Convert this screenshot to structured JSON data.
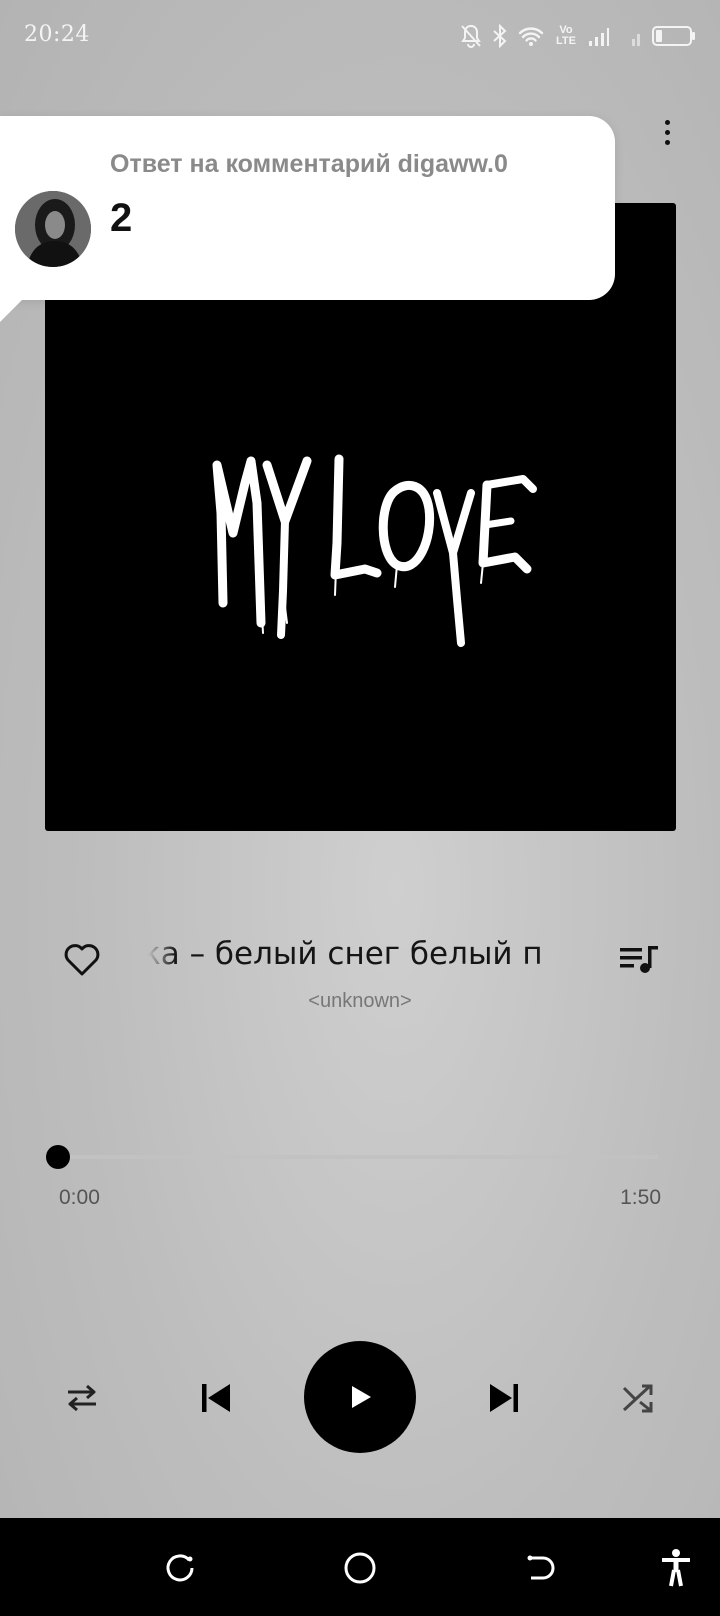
{
  "status_bar": {
    "time": "20:24",
    "network_label": "Vo LTE",
    "icons": [
      "bell-muted-icon",
      "bluetooth-icon",
      "wifi-icon",
      "signal-icon",
      "battery-icon"
    ]
  },
  "notification": {
    "title": "Ответ на комментарий digaww.0",
    "body": "2",
    "avatar": "avatar"
  },
  "album": {
    "art_text": "MY LOVE",
    "background": "#000000"
  },
  "track": {
    "title": "ка – белый снег белый п",
    "artist": "<unknown>"
  },
  "progress": {
    "current_time": "0:00",
    "total_time": "1:50",
    "fraction": 0.0
  },
  "controls": {
    "icons": [
      "repeat-icon",
      "previous-icon",
      "play-icon",
      "next-icon",
      "shuffle-icon"
    ]
  },
  "nav_bar": {
    "icons": [
      "recents-icon",
      "home-icon",
      "back-icon",
      "accessibility-icon"
    ]
  },
  "colors": {
    "background": "#bdbdbd",
    "accent": "#000000",
    "notification_bg": "#ffffff"
  }
}
